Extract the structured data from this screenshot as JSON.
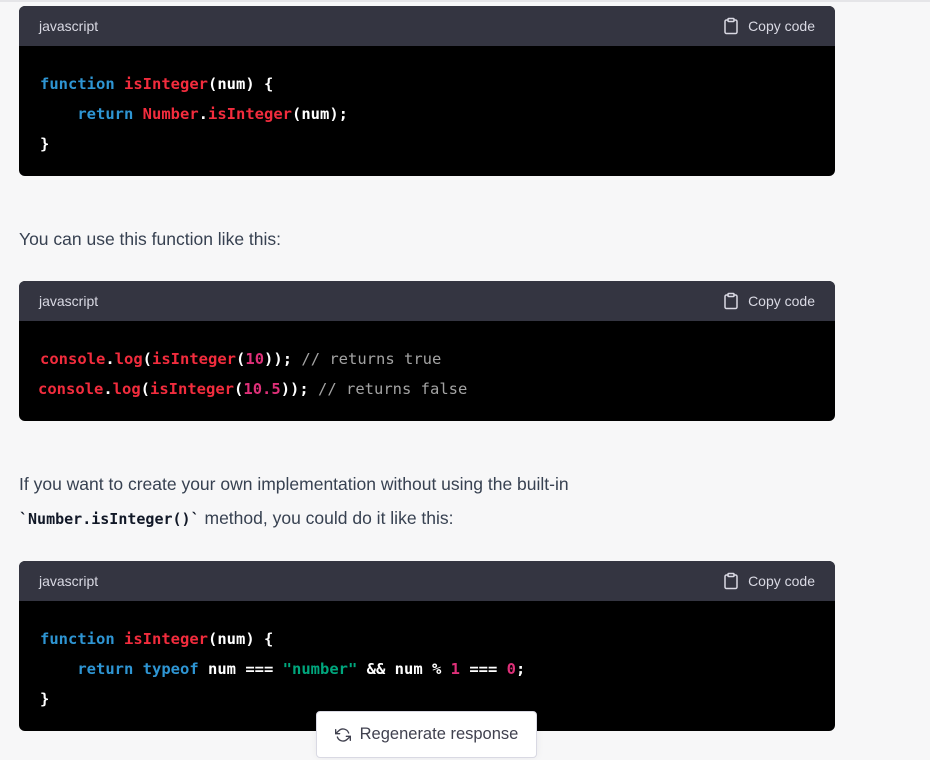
{
  "blocks": [
    {
      "language": "javascript",
      "copy_label": "Copy code"
    },
    {
      "language": "javascript",
      "copy_label": "Copy code"
    },
    {
      "language": "javascript",
      "copy_label": "Copy code"
    }
  ],
  "code1": {
    "l1_kw": "function",
    "l1_fn": "isInteger",
    "l1_rest": "(num) {",
    "l2_kw": "return",
    "l2_obj": "Number",
    "l2_dot": ".",
    "l2_fn": "isInteger",
    "l2_rest": "(num);",
    "l3": "}"
  },
  "code2": {
    "l1_obj": "console",
    "l1_dot": ".",
    "l1_fn": "log",
    "l1_p1": "(",
    "l1_fn2": "isInteger",
    "l1_p2": "(",
    "l1_num": "10",
    "l1_p3": ")); ",
    "l1_cm": "// returns true",
    "l2_obj": "console",
    "l2_dot": ".",
    "l2_fn": "log",
    "l2_p1": "(",
    "l2_fn2": "isInteger",
    "l2_p2": "(",
    "l2_num": "10.5",
    "l2_p3": ")); ",
    "l2_cm": "// returns false"
  },
  "code3": {
    "l1_kw": "function",
    "l1_fn": "isInteger",
    "l1_rest": "(num) {",
    "l2_kw": "return",
    "l2_kw2": "typeof",
    "l2_a": " num === ",
    "l2_str": "\"number\"",
    "l2_b": " && num % ",
    "l2_n1": "1",
    "l2_c": " === ",
    "l2_n2": "0",
    "l2_d": ";",
    "l3": "}"
  },
  "text1": "You can use this function like this:",
  "text2_line1": "If you want to create your own implementation without using the built-in",
  "text2_code": "`Number.isInteger()`",
  "text2_line2_rest": " method, you could do it like this:",
  "regenerate_label": "Regenerate response"
}
